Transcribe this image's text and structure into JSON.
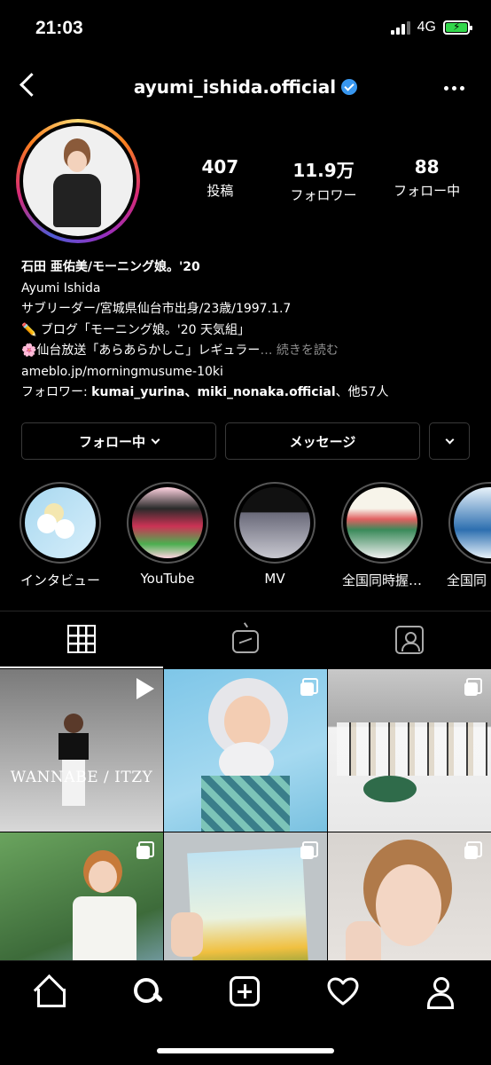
{
  "status": {
    "time": "21:03",
    "network": "4G",
    "battery_color": "#32d74b"
  },
  "header": {
    "username": "ayumi_ishida.official",
    "verified": true
  },
  "stats": [
    {
      "value": "407",
      "label": "投稿"
    },
    {
      "value": "11.9万",
      "label": "フォロワー"
    },
    {
      "value": "88",
      "label": "フォロー中"
    }
  ],
  "bio": {
    "name": "石田 亜佑美/モーニング娘。'20",
    "line1": "Ayumi Ishida",
    "line2": "サブリーダー/宮城県仙台市出身/23歳/1997.1.7",
    "line3": "✏️ ブログ「モーニング娘。'20 天気組」",
    "line4": "🌸仙台放送「あらあらかしこ」レギュラー",
    "more": "… 続きを読む",
    "link": "ameblo.jp/morningmusume-10ki",
    "followers_prefix": "フォロワー: ",
    "followers_names": "kumai_yurina、miki_nonaka.official",
    "followers_suffix": "、他57人"
  },
  "buttons": {
    "follow": "フォロー中",
    "message": "メッセージ"
  },
  "highlights": [
    {
      "label": "インタビュー"
    },
    {
      "label": "YouTube"
    },
    {
      "label": "MV"
    },
    {
      "label": "全国同時握…"
    },
    {
      "label": "全国同"
    }
  ],
  "posts": [
    {
      "type": "video",
      "overlay": "WANNABE / ITZY"
    },
    {
      "type": "carousel",
      "overlay": ""
    },
    {
      "type": "carousel",
      "overlay": ""
    },
    {
      "type": "carousel",
      "overlay": ""
    },
    {
      "type": "carousel",
      "overlay": ""
    },
    {
      "type": "carousel",
      "overlay": ""
    }
  ],
  "colors": {
    "verified": "#3897f0",
    "muted": "#8e8e8e"
  }
}
